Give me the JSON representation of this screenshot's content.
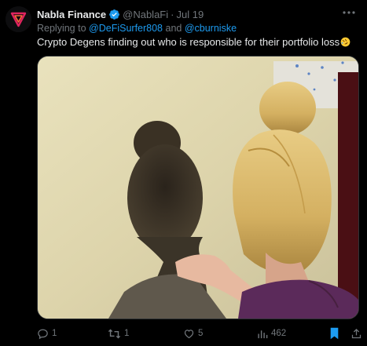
{
  "tweet": {
    "author_name": "Nabla Finance",
    "handle": "@NablaFi",
    "separator": "·",
    "date": "Jul 19",
    "reply_prefix": "Replying to",
    "reply_mention_1": "@DeFiSurfer808",
    "reply_and": "and",
    "reply_mention_2": "@cburniske",
    "text": "Crypto Degens finding out who is responsible for their portfolio loss",
    "emoji": "rolling-on-the-floor-laughing"
  },
  "actions": {
    "replies": "1",
    "retweets": "1",
    "likes": "5",
    "views": "462"
  },
  "colors": {
    "accent": "#1d9bf0",
    "muted": "#71767b",
    "text": "#e7e9ea",
    "avatar_brand": "#e0245e"
  },
  "icons": {
    "more": "more-horizontal-icon",
    "verified": "verified-badge-icon",
    "reply": "reply-icon",
    "retweet": "retweet-icon",
    "like": "heart-icon",
    "views": "views-bar-icon",
    "bookmark": "bookmark-icon",
    "share": "share-icon"
  }
}
